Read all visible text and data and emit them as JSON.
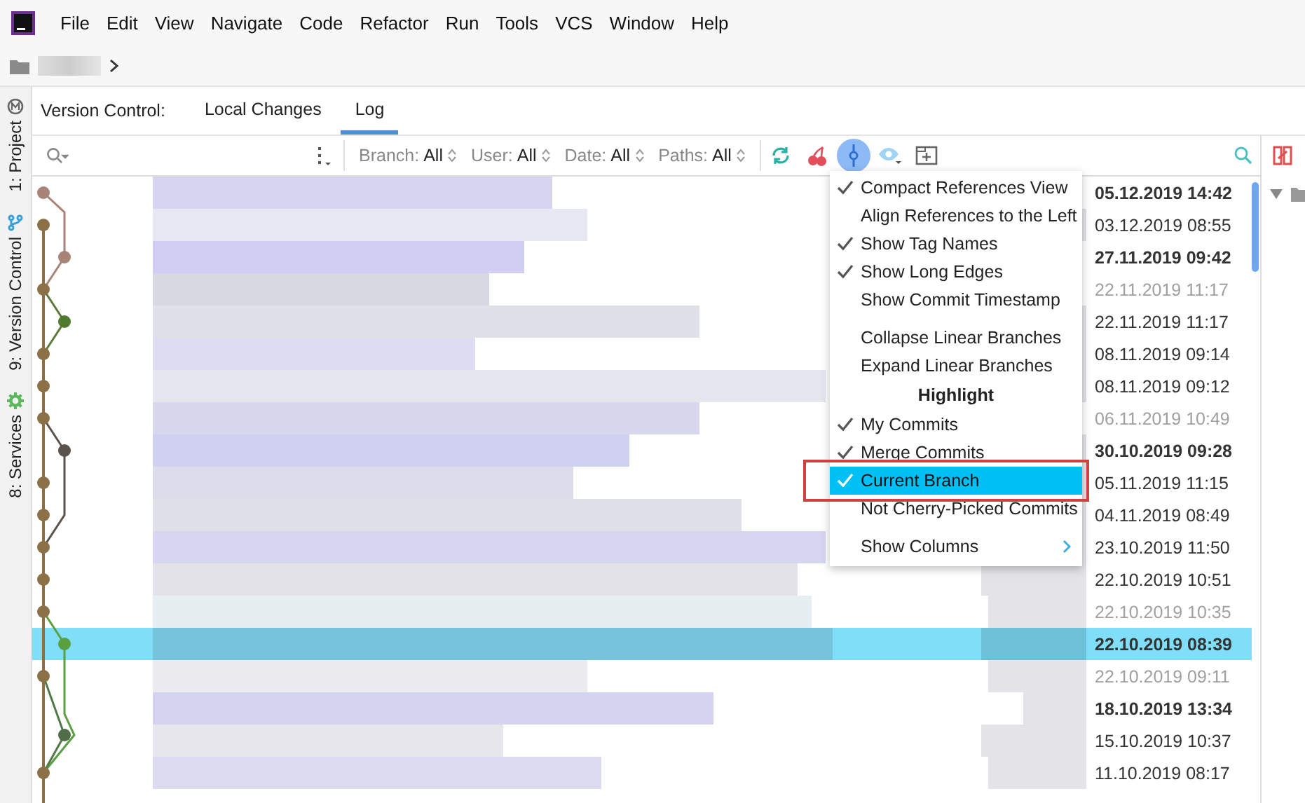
{
  "menu_bar": {
    "items": [
      "File",
      "Edit",
      "View",
      "Navigate",
      "Code",
      "Refactor",
      "Run",
      "Tools",
      "VCS",
      "Window",
      "Help"
    ]
  },
  "tool_strip": [
    {
      "kind": "project",
      "label": "1: Project"
    },
    {
      "kind": "vcs",
      "label": "9: Version Control"
    },
    {
      "kind": "services",
      "label": "8: Services"
    }
  ],
  "tabs": {
    "title": "Version Control:",
    "items": [
      {
        "label": "Local Changes",
        "selected": false
      },
      {
        "label": "Log",
        "selected": true
      }
    ]
  },
  "toolbar": {
    "filters": [
      {
        "label": "Branch:",
        "value": "All"
      },
      {
        "label": "User:",
        "value": "All"
      },
      {
        "label": "Date:",
        "value": "All"
      },
      {
        "label": "Paths:",
        "value": "All"
      }
    ],
    "highlight_on": true
  },
  "commits": [
    {
      "date": "05.12.2019 14:42",
      "highlighted": true,
      "dimmed": false,
      "selected": false
    },
    {
      "date": "03.12.2019 08:55",
      "highlighted": false,
      "dimmed": false,
      "selected": false
    },
    {
      "date": "27.11.2019 09:42",
      "highlighted": true,
      "dimmed": false,
      "selected": false
    },
    {
      "date": "22.11.2019 11:17",
      "highlighted": false,
      "dimmed": true,
      "selected": false
    },
    {
      "date": "22.11.2019 11:17",
      "highlighted": false,
      "dimmed": false,
      "selected": false
    },
    {
      "date": "08.11.2019 09:14",
      "highlighted": false,
      "dimmed": false,
      "selected": false
    },
    {
      "date": "08.11.2019 09:12",
      "highlighted": false,
      "dimmed": false,
      "selected": false
    },
    {
      "date": "06.11.2019 10:49",
      "highlighted": false,
      "dimmed": true,
      "selected": false
    },
    {
      "date": "30.10.2019 09:28",
      "highlighted": true,
      "dimmed": false,
      "selected": false
    },
    {
      "date": "05.11.2019 11:15",
      "highlighted": false,
      "dimmed": false,
      "selected": false
    },
    {
      "date": "04.11.2019 08:49",
      "highlighted": false,
      "dimmed": false,
      "selected": false
    },
    {
      "date": "23.10.2019 11:50",
      "highlighted": false,
      "dimmed": false,
      "selected": false
    },
    {
      "date": "22.10.2019 10:51",
      "highlighted": false,
      "dimmed": false,
      "selected": false
    },
    {
      "date": "22.10.2019 10:35",
      "highlighted": false,
      "dimmed": true,
      "selected": false
    },
    {
      "date": "22.10.2019 08:39",
      "highlighted": true,
      "dimmed": false,
      "selected": true
    },
    {
      "date": "22.10.2019 09:11",
      "highlighted": false,
      "dimmed": true,
      "selected": false
    },
    {
      "date": "18.10.2019 13:34",
      "highlighted": true,
      "dimmed": false,
      "selected": false
    },
    {
      "date": "15.10.2019 10:37",
      "highlighted": false,
      "dimmed": false,
      "selected": false
    },
    {
      "date": "11.10.2019 08:17",
      "highlighted": false,
      "dimmed": false,
      "selected": false
    }
  ],
  "menu": {
    "items": [
      {
        "kind": "item",
        "label": "Compact References View",
        "checked": true,
        "selected": false
      },
      {
        "kind": "item",
        "label": "Align References to the Left",
        "checked": false,
        "selected": false
      },
      {
        "kind": "item",
        "label": "Show Tag Names",
        "checked": true,
        "selected": false
      },
      {
        "kind": "item",
        "label": "Show Long Edges",
        "checked": true,
        "selected": false
      },
      {
        "kind": "item",
        "label": "Show Commit Timestamp",
        "checked": false,
        "selected": false
      },
      {
        "kind": "separator"
      },
      {
        "kind": "item",
        "label": "Collapse Linear Branches",
        "checked": false,
        "selected": false
      },
      {
        "kind": "item",
        "label": "Expand Linear Branches",
        "checked": false,
        "selected": false
      },
      {
        "kind": "header",
        "label": "Highlight"
      },
      {
        "kind": "item",
        "label": "My Commits",
        "checked": true,
        "selected": false
      },
      {
        "kind": "item",
        "label": "Merge Commits",
        "checked": true,
        "selected": false
      },
      {
        "kind": "item",
        "label": "Current Branch",
        "checked": true,
        "selected": true,
        "annotated": true
      },
      {
        "kind": "item",
        "label": "Not Cherry-Picked Commits",
        "checked": false,
        "selected": false
      },
      {
        "kind": "separator"
      },
      {
        "kind": "submenu",
        "label": "Show Columns",
        "checked": false,
        "selected": false
      }
    ]
  }
}
